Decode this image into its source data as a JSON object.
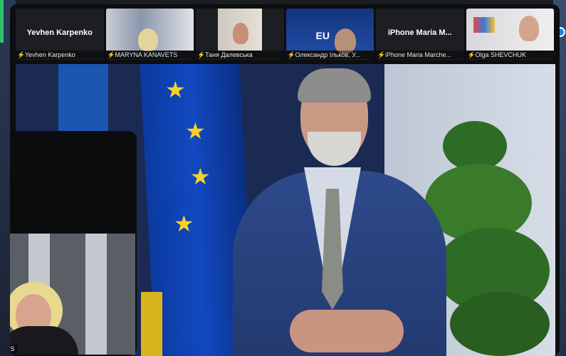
{
  "participants": [
    {
      "big_name": "Yevhen Karpenko",
      "label": "Yevhen Karpenko",
      "muted": true,
      "video": false
    },
    {
      "big_name": "",
      "label": "MARYNA KANAVETS",
      "muted": true,
      "video": true
    },
    {
      "big_name": "",
      "label": "Таня Далевська",
      "muted": true,
      "video": true
    },
    {
      "big_name": "",
      "label": "Олександр Ільков, У...",
      "muted": true,
      "video": true
    },
    {
      "big_name": "iPhone Maria M...",
      "label": "iPhone Maria Marche...",
      "muted": true,
      "video": false
    },
    {
      "big_name": "",
      "label": "Olga SHEVCHUK",
      "muted": true,
      "video": true
    }
  ],
  "side_video_label": "ETS",
  "colors": {
    "mute": "#e2474a",
    "eu_blue": "#1249c0",
    "eu_star": "#f7d12a",
    "accent": "#1e88e5"
  },
  "icons": {
    "mute": "microphone-muted-icon",
    "star": "eu-star-icon"
  }
}
